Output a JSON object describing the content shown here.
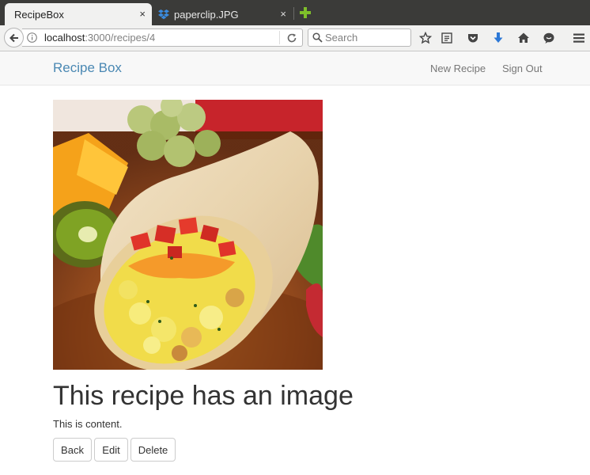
{
  "browser": {
    "tabs": [
      {
        "title": "RecipeBox",
        "close": "×"
      },
      {
        "title": "paperclip.JPG",
        "close": "×"
      }
    ],
    "url_host": "localhost",
    "url_path": ":3000/recipes/4",
    "search_placeholder": "Search",
    "icons": [
      "back-arrow-icon",
      "info-icon",
      "reload-icon",
      "search-icon",
      "bookmark-star-icon",
      "reading-list-icon",
      "pocket-icon",
      "download-icon",
      "home-icon",
      "chat-icon",
      "menu-icon",
      "new-tab-plus-icon",
      "dropbox-icon"
    ]
  },
  "navbar": {
    "brand": "Recipe Box",
    "links": [
      {
        "label": "New Recipe"
      },
      {
        "label": "Sign Out"
      }
    ]
  },
  "recipe": {
    "title": "This recipe has an image",
    "content": "This is content."
  },
  "actions": {
    "back": "Back",
    "edit": "Edit",
    "delete": "Delete"
  },
  "colors": {
    "brand_link": "#4a88b3",
    "nav_link": "#777777",
    "download_icon": "#2c78d6",
    "new_tab_plus": "#7fbf2a"
  }
}
